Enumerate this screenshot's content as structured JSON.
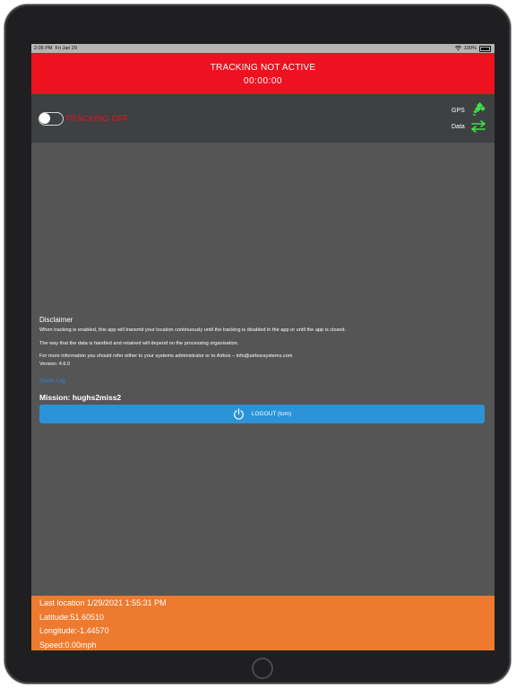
{
  "status_bar": {
    "time": "2:05 PM",
    "date": "Fri Jan 29",
    "battery": "100%"
  },
  "header": {
    "status": "TRACKING NOT ACTIVE",
    "timer": "00:00:00"
  },
  "controls": {
    "tracking_label": "TRACKING OFF",
    "tracking_enabled": false,
    "gps_label": "GPS",
    "data_label": "Data",
    "indicator_color": "#3ee04a"
  },
  "disclaimer": {
    "title": "Disclaimer",
    "paragraph1": "When tracking is enabled, this app will transmit your location continuously until the tracking is disabled in the app or until the app is closed.",
    "paragraph2": "The way that the data is handled and retained will depend on the processing organisation.",
    "paragraph3": "For more information you should refer either to your systems administrator or to Airbox – info@airboxsystems.com",
    "version": "Version: 4.6.0"
  },
  "show_log_label": "Show Log",
  "mission": "Mission: hughs2miss2",
  "logout_label": "LOGOUT (tom)",
  "location": {
    "last_location": "Last location 1/29/2021 1:55:31 PM",
    "latitude": "Latitude:51.60510",
    "longitude": "Longitude:-1.44570",
    "speed": "Speed:0.00mph"
  },
  "colors": {
    "alert_red": "#ee1120",
    "button_blue": "#2b93d8",
    "location_orange": "#ed7a2e"
  }
}
